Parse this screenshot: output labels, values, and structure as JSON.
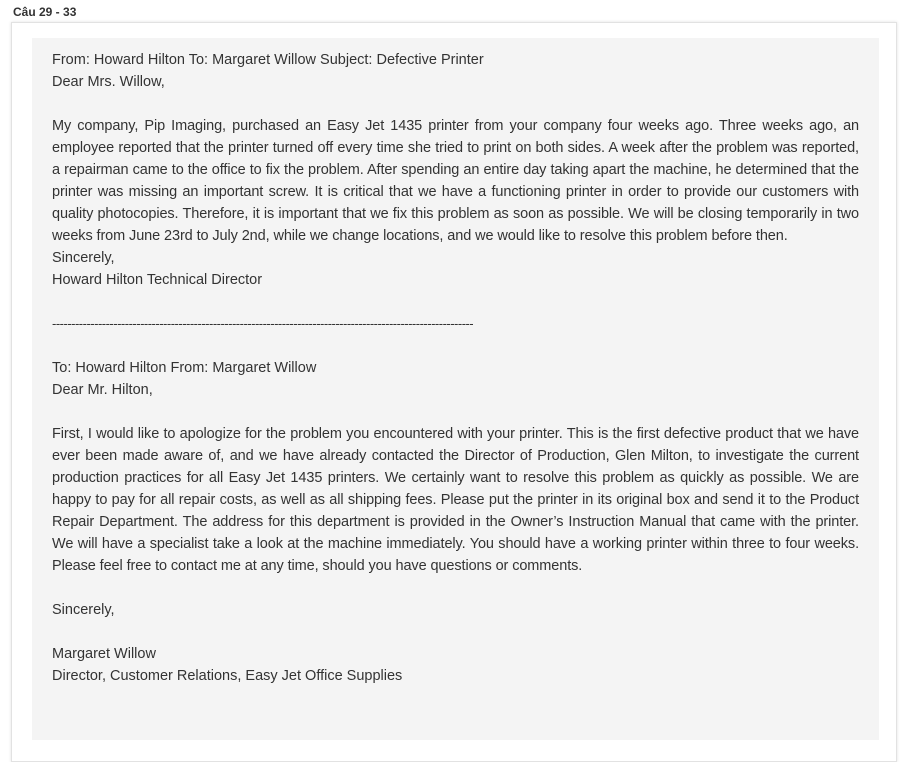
{
  "heading": "Câu 29 - 33",
  "email1": {
    "header": "From: Howard Hilton To: Margaret Willow Subject: Defective Printer",
    "greeting": "Dear Mrs. Willow,",
    "body": "My company, Pip Imaging, purchased an Easy Jet 1435 printer from your company four weeks ago. Three weeks ago, an employee reported that the printer turned off every time she tried to print on both sides. A week after the problem was reported, a repairman came to the office to fix the problem. After spending an entire day taking apart the machine, he determined that the printer was missing an important screw. It is critical that we have a functioning printer in order to provide our customers with quality photocopies. Therefore, it is important that we fix this problem as soon as possible. We will be closing temporarily in two weeks from June 23rd to July 2nd, while we change locations, and we would like to resolve this problem before then.",
    "closing": "Sincerely,",
    "signature": "Howard Hilton Technical Director"
  },
  "separator": "--------------------------------------------------------------------------------------------------------------------",
  "email2": {
    "header": "To: Howard Hilton From: Margaret Willow",
    "greeting": "Dear Mr. Hilton,",
    "body": "First, I would like to apologize for the problem you encountered with your printer. This is the first defective product that we have ever been made aware of, and we have already contacted the Director of Production, Glen Milton, to investigate the current production practices for all Easy Jet 1435 printers. We certainly want to resolve this problem as quickly as possible. We are happy to pay for all repair costs, as well as all shipping fees. Please put the printer in its original box and send it to the Product Repair Department. The address for this department is provided in the Owner’s Instruction Manual that came with the printer. We will have a specialist take a look at the machine immediately. You should have a working printer within three to four weeks. Please feel free to contact me at any time, should you have questions or comments.",
    "closing": "Sincerely,",
    "signature_name": "Margaret Willow",
    "signature_title": "Director, Customer Relations, Easy Jet Office Supplies"
  }
}
